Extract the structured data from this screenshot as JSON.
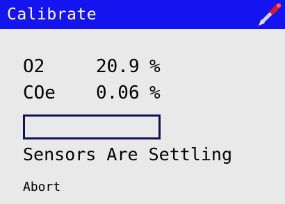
{
  "header": {
    "title": "Calibrate",
    "icon": "probe-icon",
    "accent_color": "#1414f0"
  },
  "readings": [
    {
      "label": "O2",
      "value": "20.9",
      "unit": "%"
    },
    {
      "label": "COe",
      "value": "0.06",
      "unit": "%"
    }
  ],
  "progress": {
    "fraction": 0
  },
  "status": {
    "message": "Sensors Are Settling"
  },
  "actions": {
    "abort_label": "Abort"
  }
}
